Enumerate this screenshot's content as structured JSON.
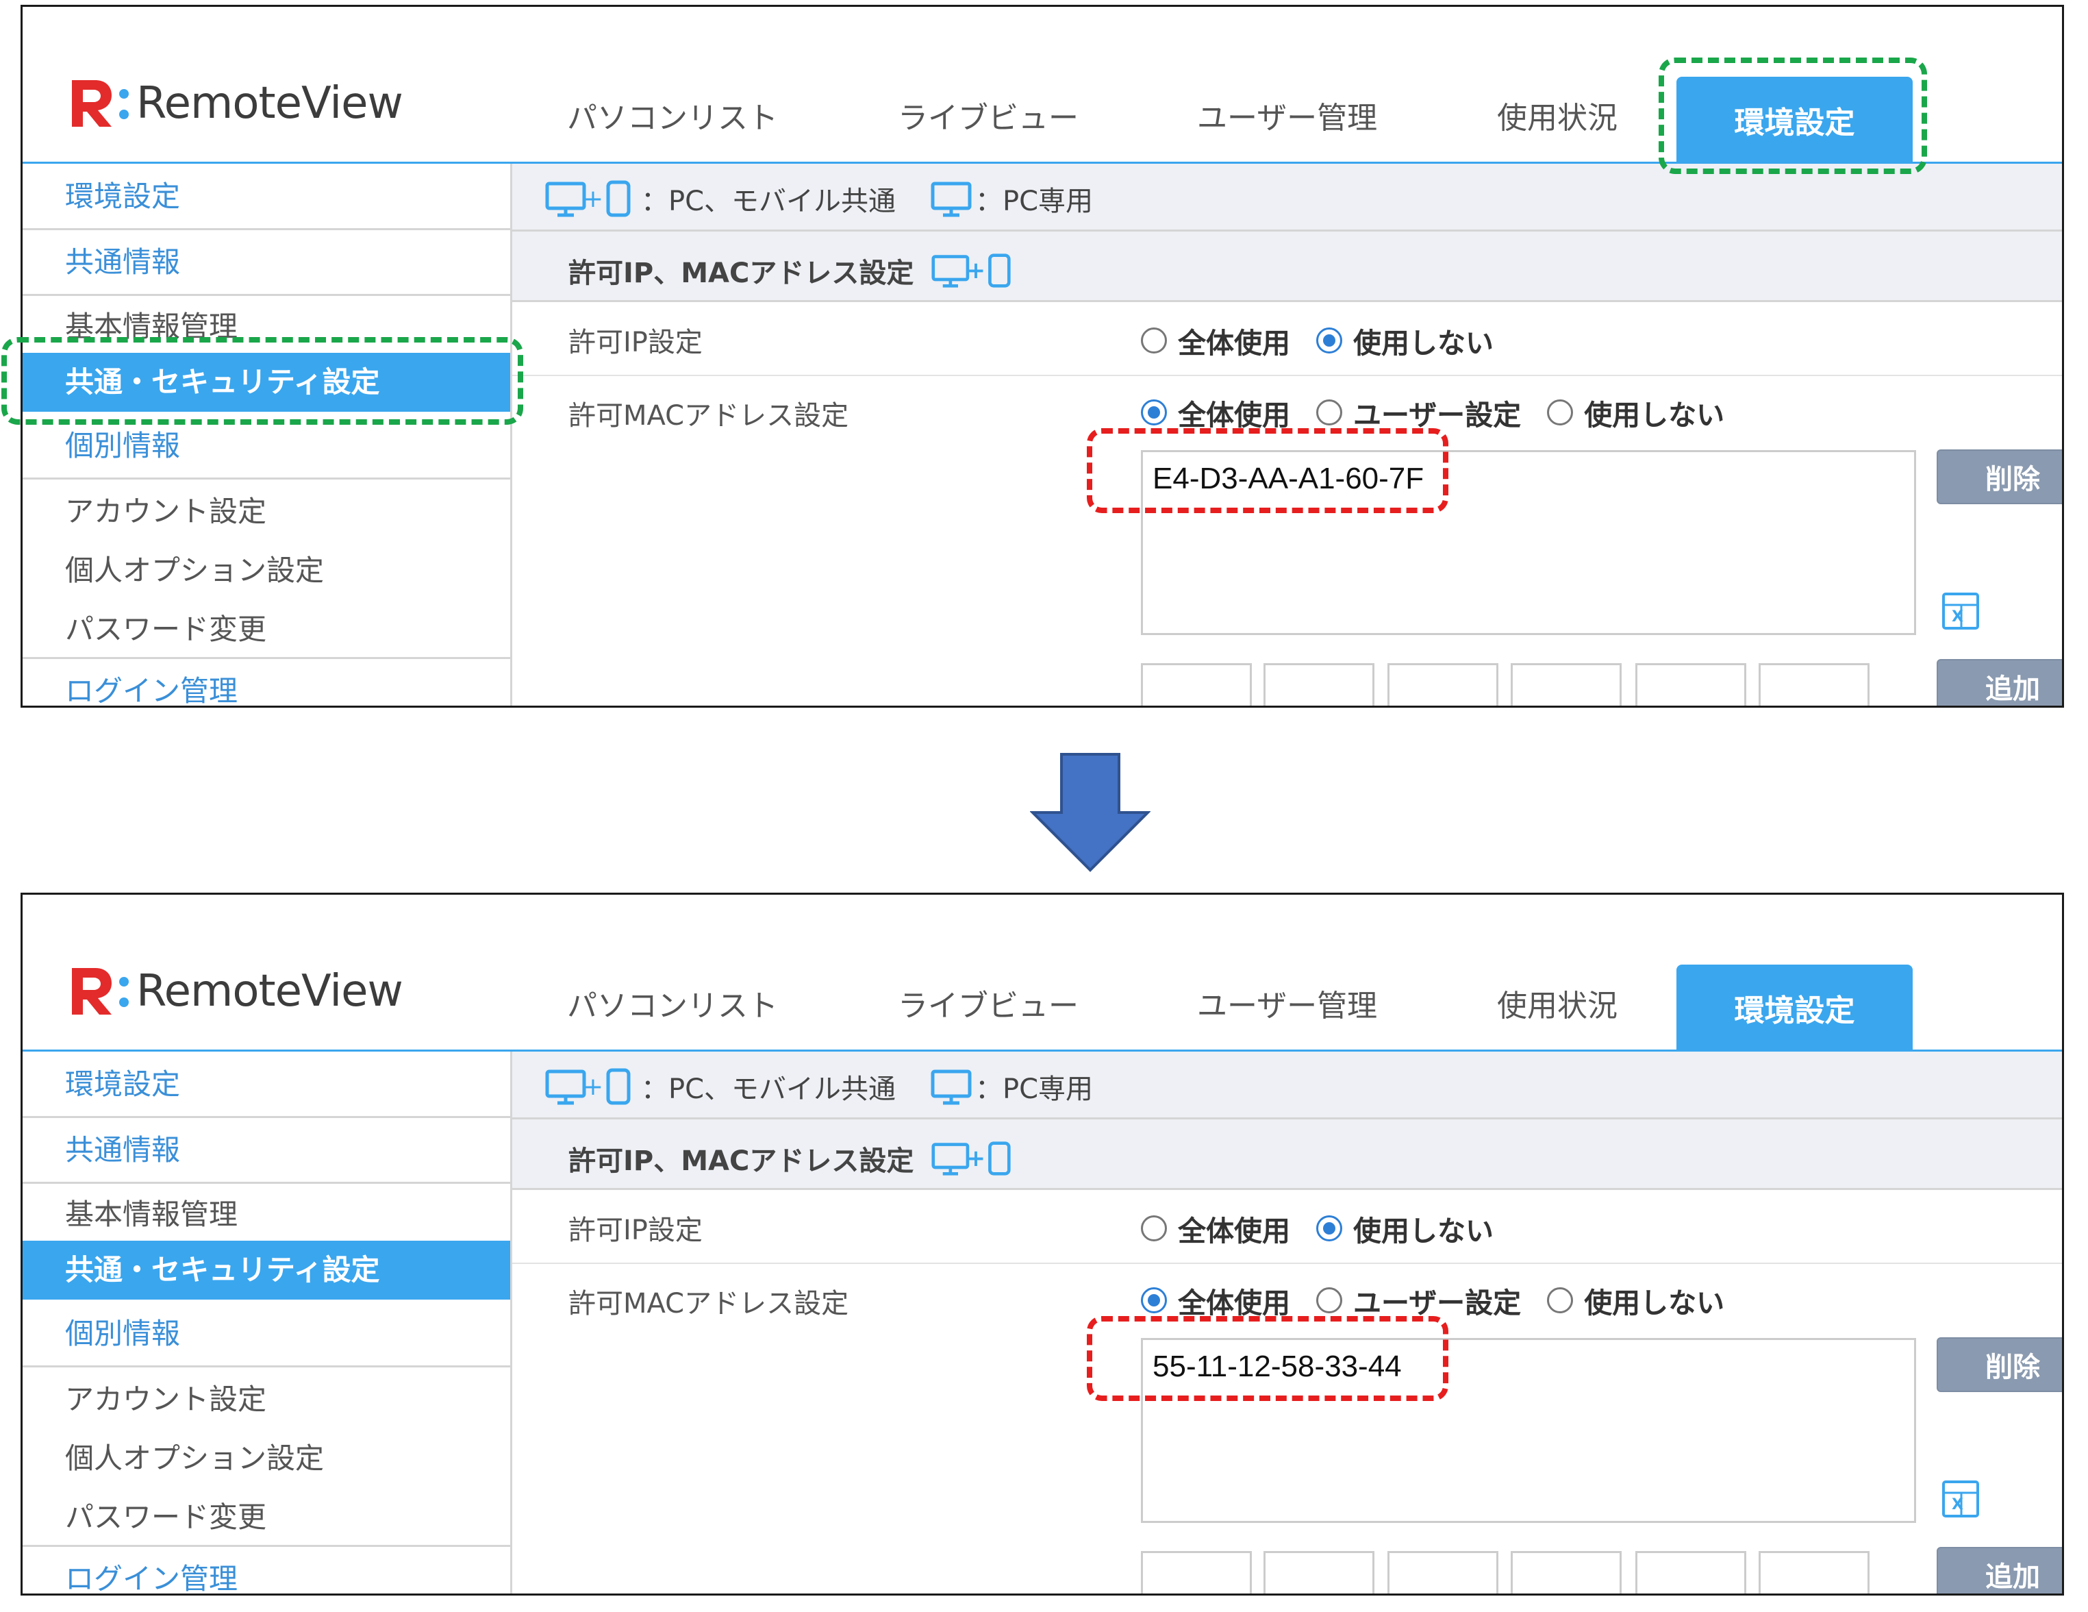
{
  "app": {
    "logo_text": "RemoteView"
  },
  "nav": [
    {
      "label": "パソコンリスト"
    },
    {
      "label": "ライブビュー"
    },
    {
      "label": "ユーザー管理"
    },
    {
      "label": "使用状況"
    },
    {
      "label": "環境設定",
      "active": true
    }
  ],
  "sidebar": [
    {
      "label": "環境設定",
      "type": "category"
    },
    {
      "label": "共通情報",
      "type": "category"
    },
    {
      "label": "基本情報管理",
      "type": "item"
    },
    {
      "label": "共通・セキュリティ設定",
      "type": "item",
      "active": true
    },
    {
      "label": "個別情報",
      "type": "category"
    },
    {
      "label": "アカウント設定",
      "type": "item"
    },
    {
      "label": "個人オプション設定",
      "type": "item"
    },
    {
      "label": "パスワード変更",
      "type": "item"
    },
    {
      "label": "ログイン管理",
      "type": "category"
    }
  ],
  "legend": {
    "shared": "：PC、モバイル共通",
    "pc_only": "：PC専用"
  },
  "section": {
    "title": "許可IP、MACアドレス設定",
    "ip_label": "許可IP設定",
    "ip_options": [
      {
        "label": "全体使用",
        "selected": false
      },
      {
        "label": "使用しない",
        "selected": true
      }
    ],
    "mac_label": "許可MACアドレス設定",
    "mac_options": [
      {
        "label": "全体使用",
        "selected": true
      },
      {
        "label": "ユーザー設定",
        "selected": false
      },
      {
        "label": "使用しない",
        "selected": false
      }
    ],
    "delete_label": "削除",
    "add_label": "追加"
  },
  "before": {
    "mac_value": "E4-D3-AA-A1-60-7F"
  },
  "after": {
    "mac_value": "55-11-12-58-33-44"
  },
  "colors": {
    "accent": "#3aa6ee",
    "highlight_nav": "#1aa64a",
    "highlight_value": "#e61e1e",
    "arrow": "#4472c4"
  }
}
